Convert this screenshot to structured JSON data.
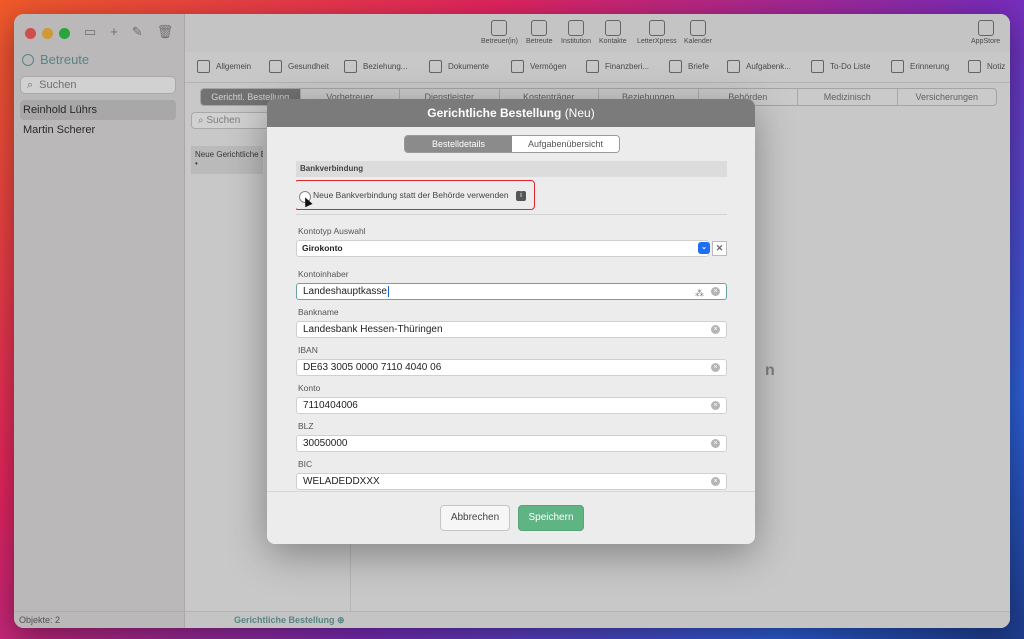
{
  "sidebar": {
    "title": "Betreute",
    "search_placeholder": "Suchen",
    "items": [
      {
        "label": "Reinhold Lührs"
      },
      {
        "label": "Martin Scherer"
      }
    ],
    "footer": "Objekte: 2"
  },
  "topbar": {
    "icons": [
      {
        "label": "Betreuer(in)",
        "icon": "person-icon"
      },
      {
        "label": "Betreute",
        "icon": "person-icon"
      },
      {
        "label": "Institution",
        "icon": "building-icon"
      },
      {
        "label": "Kontakte",
        "icon": "contact-icon"
      },
      {
        "label": "LetterXpress",
        "icon": "letter-icon"
      },
      {
        "label": "Kalender",
        "icon": "alarm-icon"
      }
    ],
    "appstore": "AppStore"
  },
  "navbar": {
    "items": [
      {
        "label": "Allgemein"
      },
      {
        "label": "Gesundheit"
      },
      {
        "label": "Beziehung..."
      },
      {
        "label": "Dokumente"
      },
      {
        "label": "Vermögen"
      },
      {
        "label": "Finanzberi..."
      },
      {
        "label": "Briefe"
      },
      {
        "label": "Aufgabenk..."
      },
      {
        "label": "To-Do Liste"
      },
      {
        "label": "Erinnerung"
      },
      {
        "label": "Notiz"
      }
    ]
  },
  "subtabs": [
    "Gerichtl. Bestellung",
    "Vorbetreuer",
    "Dienstleister",
    "Kostenträger",
    "Beziehungen",
    "Behörden",
    "Medizinisch",
    "Versicherungen"
  ],
  "list": {
    "search_placeholder": "Suchen",
    "item": "Neue Gerichtliche B",
    "item_sub": "•"
  },
  "main_footer": "Gerichtliche Bestellung ⊕",
  "bg_text": "n",
  "modal": {
    "title_bold": "Gerichtliche Bestellung",
    "title_suffix": "(Neu)",
    "seg": [
      "Bestelldetails",
      "Aufgabenübersicht"
    ],
    "section": "Bankverbindung",
    "radio_label": "Neue Bankverbindung statt der Behörde verwenden",
    "info": "i",
    "kontotyp_label": "Kontotyp Auswahl",
    "kontotyp_value": "Girokonto",
    "fields": [
      {
        "label": "Kontoinhaber",
        "value": "Landeshauptkasse"
      },
      {
        "label": "Bankname",
        "value": "Landesbank Hessen-Thüringen"
      },
      {
        "label": "IBAN",
        "value": "DE63 3005 0000 7110 4040 06"
      },
      {
        "label": "Konto",
        "value": "7110404006"
      },
      {
        "label": "BLZ",
        "value": "30050000"
      },
      {
        "label": "BIC",
        "value": "WELADEDDXXX"
      }
    ],
    "cancel": "Abbrechen",
    "save": "Speichern"
  }
}
